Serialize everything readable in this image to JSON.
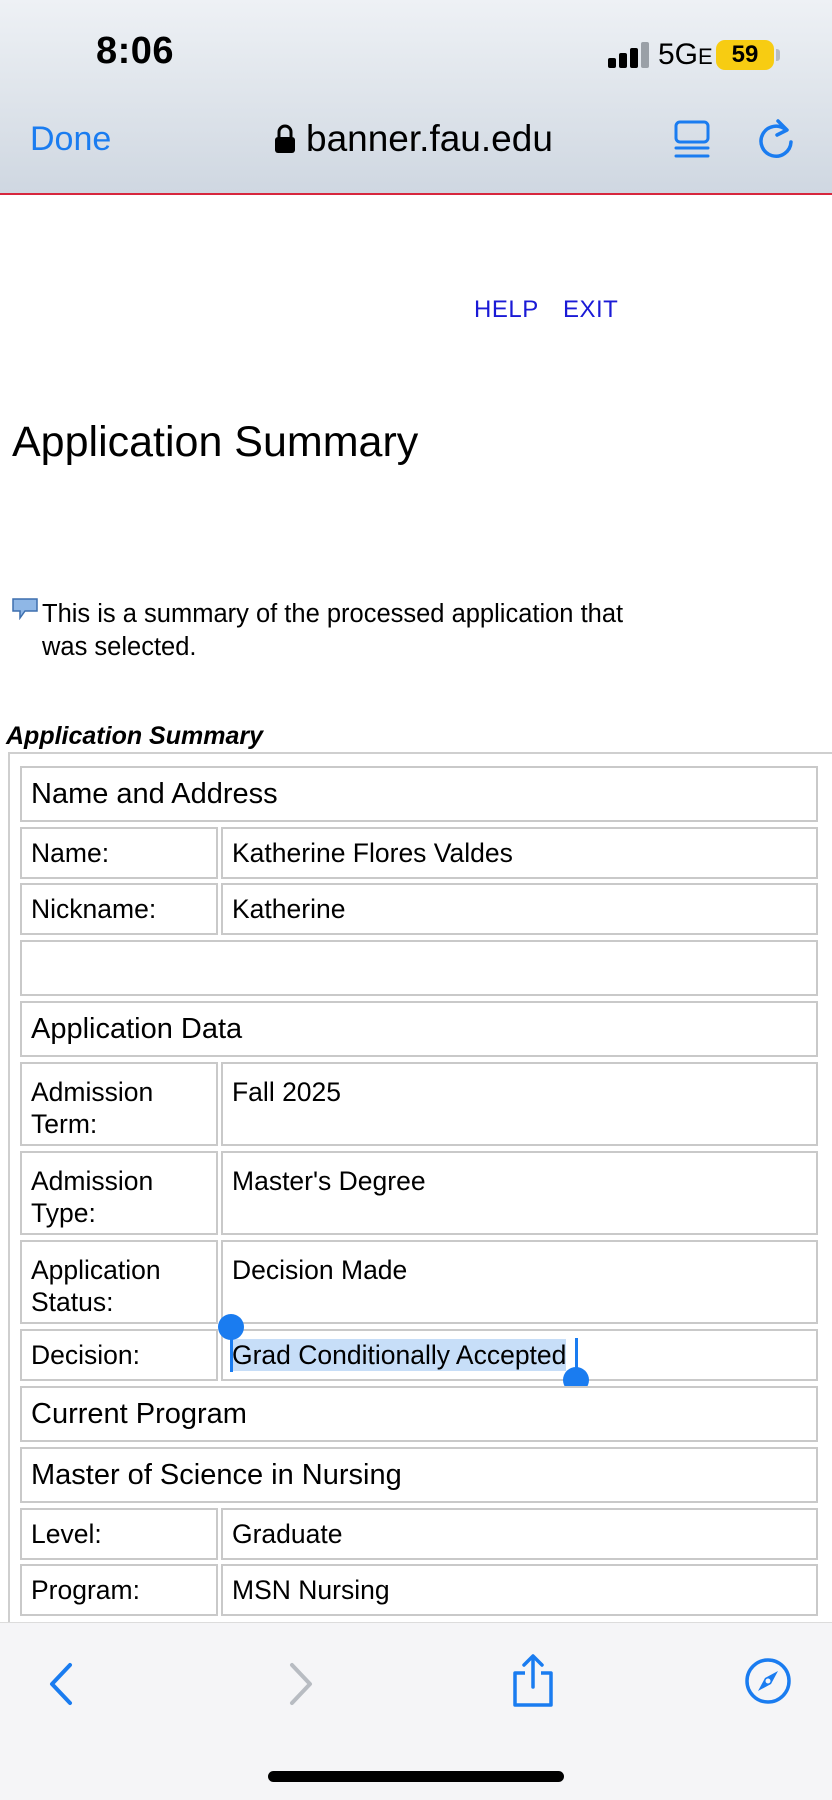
{
  "status_bar": {
    "time": "8:06",
    "network": "5G",
    "network_suffix": "E",
    "battery": "59"
  },
  "browser": {
    "done_label": "Done",
    "url": "banner.fau.edu"
  },
  "page": {
    "help_link": "HELP",
    "exit_link": "EXIT",
    "title": "Application Summary",
    "intro": "This is a summary of the processed application that was selected.",
    "table_caption": "Application Summary"
  },
  "summary": {
    "name_address_header": "Name and Address",
    "name_label": "Name:",
    "name_value": "Katherine Flores Valdes",
    "nickname_label": "Nickname:",
    "nickname_value": "Katherine",
    "application_data_header": "Application Data",
    "admission_term_label": "Admission Term:",
    "admission_term_value": "Fall 2025",
    "admission_type_label": "Admission Type:",
    "admission_type_value": "Master's Degree",
    "application_status_label": "Application Status:",
    "application_status_value": "Decision Made",
    "decision_label": "Decision:",
    "decision_value": "Grad Conditionally Accepted",
    "current_program_header": "Current Program",
    "program_name": "Master of Science in Nursing",
    "level_label": "Level:",
    "level_value": "Graduate",
    "program_label": "Program:",
    "program_value": "MSN Nursing"
  },
  "colors": {
    "accent": "#1a7cf0",
    "link": "#1a1ad6",
    "selection": "#c7def8",
    "battery": "#f7cc12",
    "header_border": "#d7263d"
  }
}
